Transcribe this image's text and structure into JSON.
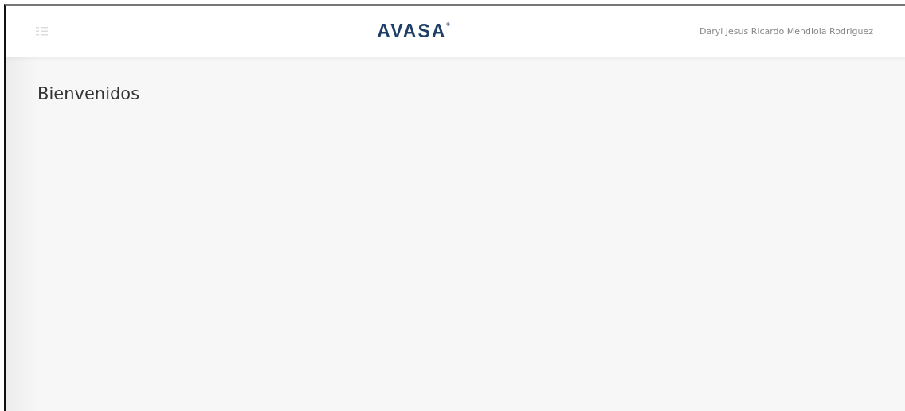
{
  "header": {
    "logo": "AVASA",
    "logo_mark": "®",
    "user_name": "Daryl Jesus Ricardo Mendiola Rodriguez"
  },
  "content": {
    "title": "Bienvenidos"
  }
}
